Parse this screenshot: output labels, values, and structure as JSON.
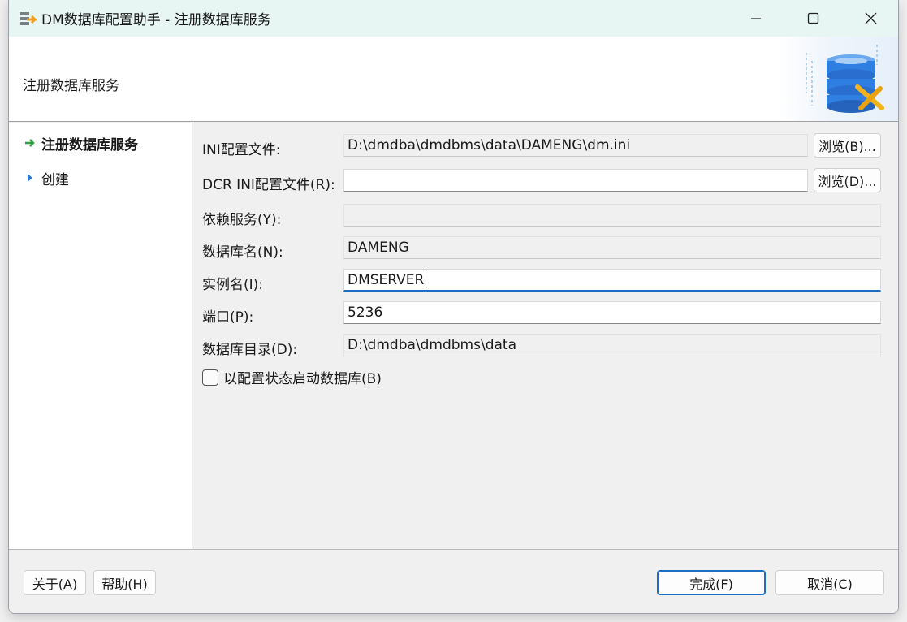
{
  "window": {
    "title": "DM数据库配置助手 - 注册数据库服务",
    "controls": [
      "minimize",
      "maximize",
      "close"
    ]
  },
  "header": {
    "title": "注册数据库服务",
    "graphic_icon": "database-tools-icon"
  },
  "nav": {
    "items": [
      {
        "label": "注册数据库服务",
        "state": "current",
        "icon": "green-arrow-right-icon"
      },
      {
        "label": "创建",
        "state": "pending",
        "icon": "blue-triangle-right-icon"
      }
    ]
  },
  "form": {
    "ini_file": {
      "label": "INI配置文件:",
      "value": "D:\\dmdba\\dmdbms\\data\\DAMENG\\dm.ini",
      "browse": "浏览(B)..."
    },
    "dcr_ini_file": {
      "label": "DCR INI配置文件(R):",
      "value": "",
      "browse": "浏览(D)..."
    },
    "depend_service": {
      "label": "依赖服务(Y):",
      "value": ""
    },
    "db_name": {
      "label": "数据库名(N):",
      "value": "DAMENG"
    },
    "instance_name": {
      "label": "实例名(I):",
      "value": "DMSERVER"
    },
    "port": {
      "label": "端口(P):",
      "value": "5236"
    },
    "db_dir": {
      "label": "数据库目录(D):",
      "value": "D:\\dmdba\\dmdbms\\data"
    },
    "start_checkbox": {
      "label": "以配置状态启动数据库(B)",
      "checked": false
    }
  },
  "footer": {
    "about": "关于(A)",
    "help": "帮助(H)",
    "finish": "完成(F)",
    "cancel": "取消(C)"
  },
  "colors": {
    "titlebar_bg": "#e8f6f3",
    "accent": "#1b6ec2",
    "nav_current_arrow": "#2e9e3e",
    "nav_pending_arrow": "#2f77c9"
  }
}
